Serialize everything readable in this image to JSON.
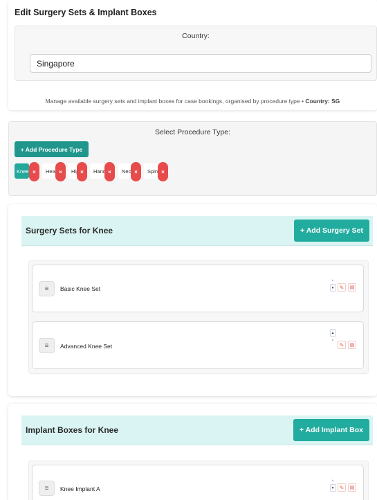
{
  "header": {
    "title": "Edit Surgery Sets & Implant Boxes",
    "country_label": "Country:",
    "country_value": "Singapore",
    "manage_text": "Manage available surgery sets and implant boxes for case bookings, organised by procedure type •",
    "manage_country": "Country: SG"
  },
  "procedure": {
    "label": "Select Procedure Type:",
    "add_button": "+ Add Procedure Type",
    "chips": [
      "Knee",
      "Head",
      "Hip",
      "Hand",
      "Neck",
      "Spine"
    ],
    "active_chip": "Knee",
    "remove_glyph": "×"
  },
  "surgery_sets": {
    "title": "Surgery Sets for Knee",
    "add_button": "+ Add Surgery Set",
    "items": [
      "Basic Knee Set",
      "Advanced Knee Set"
    ]
  },
  "implant_boxes": {
    "title": "Implant Boxes for Knee",
    "add_button": "+ Add Implant Box",
    "items": [
      "Knee Implant A"
    ]
  },
  "glyphs": {
    "drag": "≡",
    "up": "▲",
    "down": "▼",
    "edit": "✎",
    "delete": "▤"
  },
  "colors": {
    "teal_button": "#22ac9f",
    "teal_dark": "#20968c",
    "header_bg": "#d9f4f2",
    "remove_red": "#e84b4b"
  }
}
